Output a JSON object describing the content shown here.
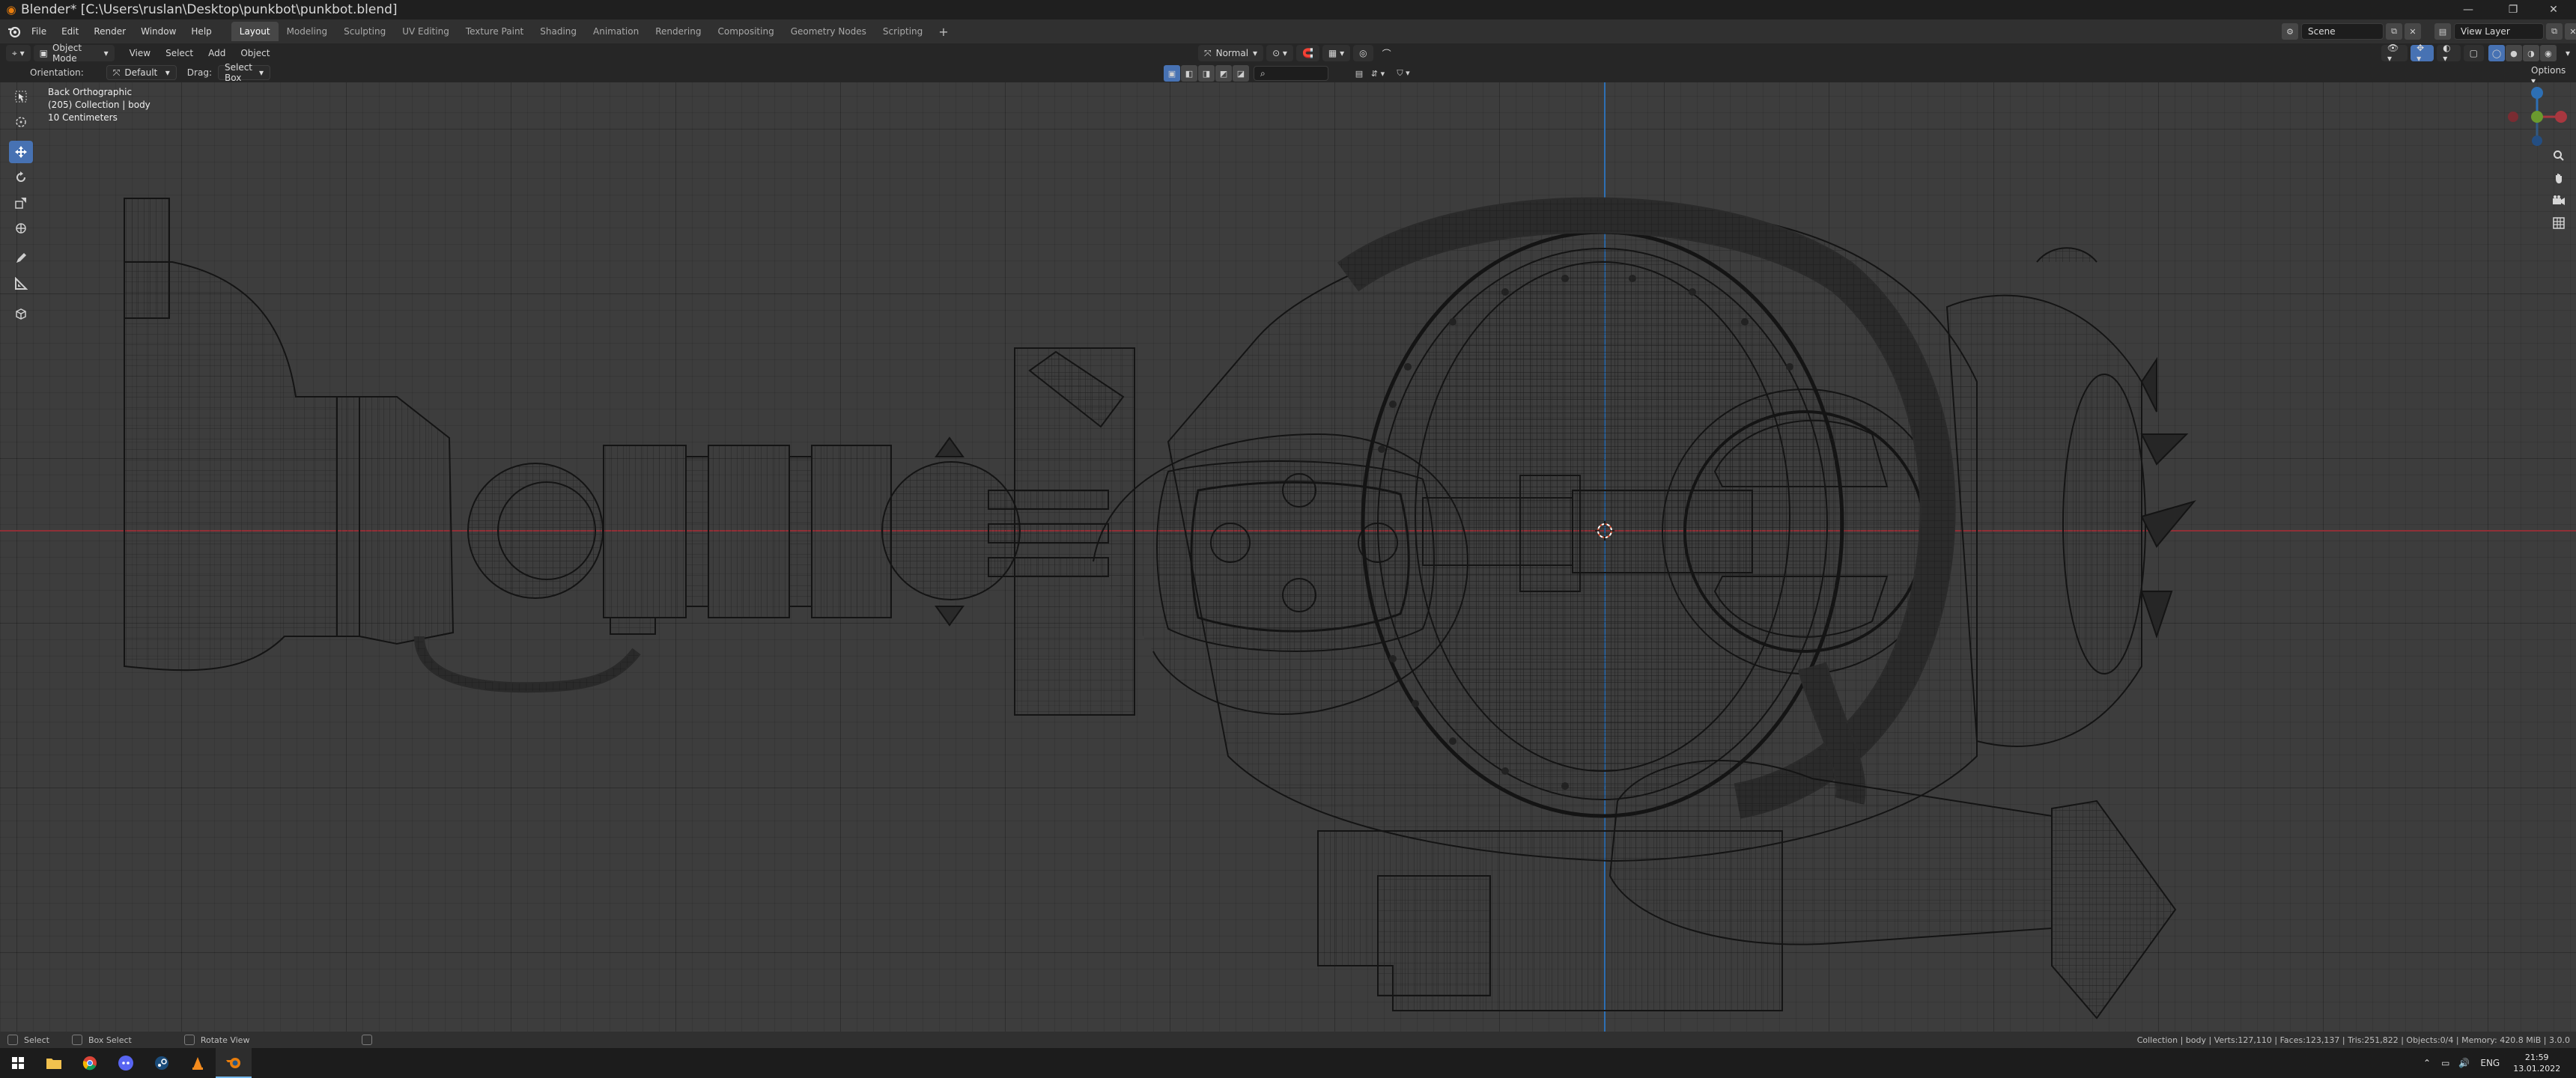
{
  "titlebar": {
    "title": "Blender* [C:\\Users\\ruslan\\Desktop\\punkbot\\punkbot.blend]",
    "minimize": "—",
    "maximize": "❐",
    "close": "✕"
  },
  "menubar": {
    "menus": [
      "File",
      "Edit",
      "Render",
      "Window",
      "Help"
    ],
    "workspaces": [
      "Layout",
      "Modeling",
      "Sculpting",
      "UV Editing",
      "Texture Paint",
      "Shading",
      "Animation",
      "Rendering",
      "Compositing",
      "Geometry Nodes",
      "Scripting"
    ],
    "active_workspace": "Layout",
    "add_tab": "+",
    "scene_label": "Scene",
    "view_layer_label": "View Layer"
  },
  "viewport_header": {
    "mode": "Object Mode",
    "menus": [
      "View",
      "Select",
      "Add",
      "Object"
    ],
    "transform_orientation": "Normal",
    "options": "Options"
  },
  "tool_settings": {
    "orientation_label": "Orientation:",
    "orientation_value": "Default",
    "drag_label": "Drag:",
    "drag_value": "Select Box"
  },
  "viewport_overlay": {
    "view_name": "Back Orthographic",
    "collection": "(205) Collection | body",
    "scale": "10 Centimeters"
  },
  "toolbar": {
    "tools": [
      {
        "name": "select-box",
        "active": false
      },
      {
        "name": "cursor",
        "active": false
      },
      {
        "name": "move",
        "active": true
      },
      {
        "name": "rotate",
        "active": false
      },
      {
        "name": "scale",
        "active": false
      },
      {
        "name": "transform",
        "active": false
      },
      {
        "name": "annotate",
        "active": false
      },
      {
        "name": "measure",
        "active": false
      },
      {
        "name": "add-cube",
        "active": false
      }
    ]
  },
  "statusbar": {
    "select": "Select",
    "box_select": "Box Select",
    "rotate_view": "Rotate View",
    "stats": "Collection | body | Verts:127,110 | Faces:123,137 | Tris:251,822 | Objects:0/4 | Memory: 420.8 MiB | 3.0.0"
  },
  "taskbar": {
    "language": "ENG",
    "time": "21:59",
    "date": "13.01.2022"
  },
  "colors": {
    "accent": "#4772b3",
    "x_axis": "#a8373f",
    "y_axis": "#5a8a2a",
    "z_axis": "#2d6fb4",
    "viewport_bg": "#3d3d3d",
    "wire": "#111111"
  }
}
